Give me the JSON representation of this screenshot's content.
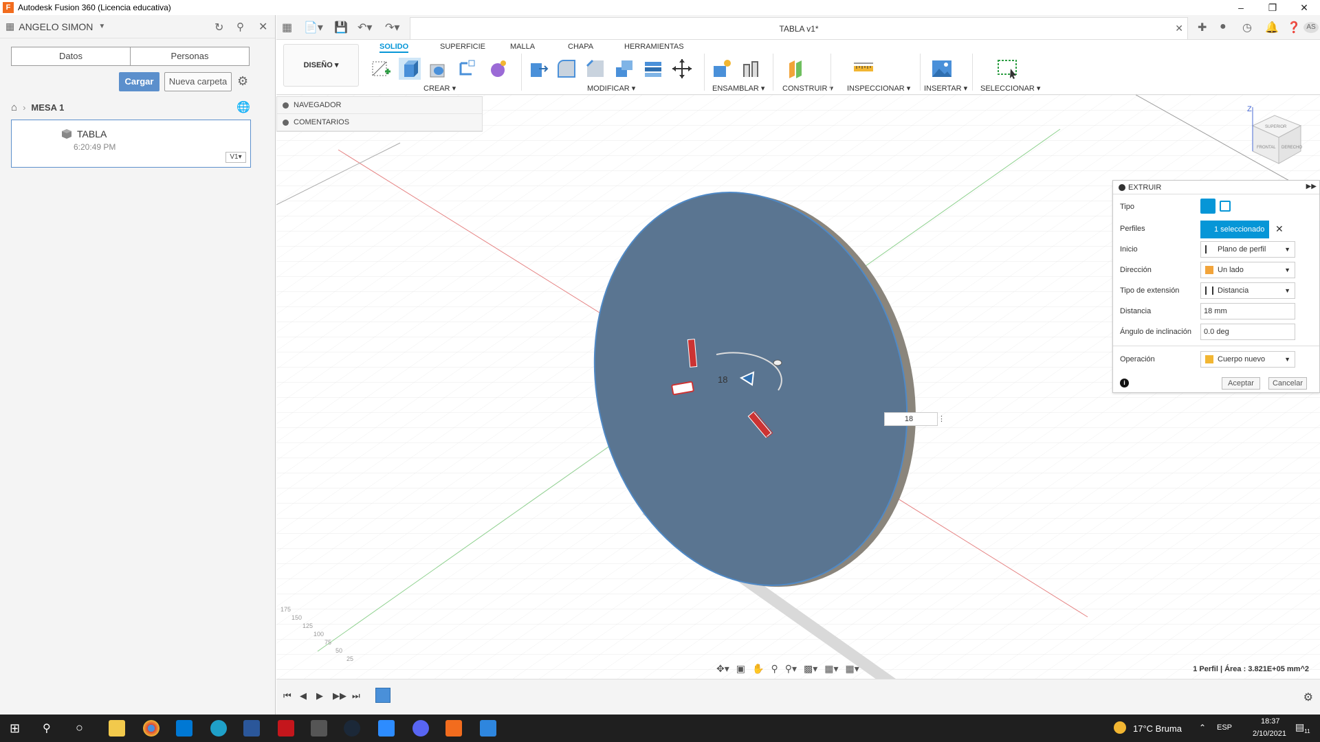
{
  "window": {
    "title": "Autodesk Fusion 360 (Licencia educativa)"
  },
  "data_panel": {
    "user": "ANGELO SIMON",
    "tabs": [
      "Datos",
      "Personas"
    ],
    "upload_button": "Cargar",
    "new_folder_button": "Nueva carpeta",
    "breadcrumb": "MESA 1",
    "file": {
      "name": "TABLA",
      "time": "6:20:49 PM",
      "version": "V1"
    }
  },
  "document": {
    "tab_title": "TABLA v1*"
  },
  "ribbon": {
    "workspace": "DISEÑO",
    "tabs": [
      "SOLIDO",
      "SUPERFICIE",
      "MALLA",
      "CHAPA",
      "HERRAMIENTAS"
    ],
    "groups": [
      "CREAR",
      "MODIFICAR",
      "ENSAMBLAR",
      "CONSTRUIR",
      "INSPECCIONAR",
      "INSERTAR",
      "SELECCIONAR"
    ]
  },
  "browser": {
    "items": [
      "NAVEGADOR",
      "COMENTARIOS"
    ]
  },
  "extrude_dialog": {
    "title": "EXTRUIR",
    "rows": {
      "tipo": "Tipo",
      "perfiles": "Perfiles",
      "inicio": "Inicio",
      "direccion": "Dirección",
      "tipo_extension": "Tipo de extensión",
      "distancia": "Distancia",
      "angulo": "Ángulo de inclinación",
      "operacion": "Operación"
    },
    "values": {
      "perfiles": "1 seleccionado",
      "inicio": "Plano de perfil",
      "direccion": "Un lado",
      "tipo_extension": "Distancia",
      "distancia": "18 mm",
      "angulo": "0.0 deg",
      "operacion": "Cuerpo nuevo"
    },
    "accept": "Aceptar",
    "cancel": "Cancelar"
  },
  "viewport": {
    "distance_input": "18",
    "distance_label": "18",
    "status": "1 Perfil | Área : 3.821E+05 mm^2",
    "viewcube_labels": [
      "SUPERIOR",
      "FRONTAL",
      "DERECHO"
    ],
    "axis_z": "Z",
    "ruler_values": [
      "175",
      "150",
      "125",
      "100",
      "75",
      "50",
      "25"
    ]
  },
  "taskbar": {
    "weather": "17°C Bruma",
    "language": "ESP",
    "time": "18:37",
    "date": "2/10/2021",
    "notifications": "11"
  },
  "colors": {
    "accent": "#0696d7",
    "disk": "#5a7591",
    "axis_red": "#e06666",
    "axis_green": "#7dcf7d"
  }
}
